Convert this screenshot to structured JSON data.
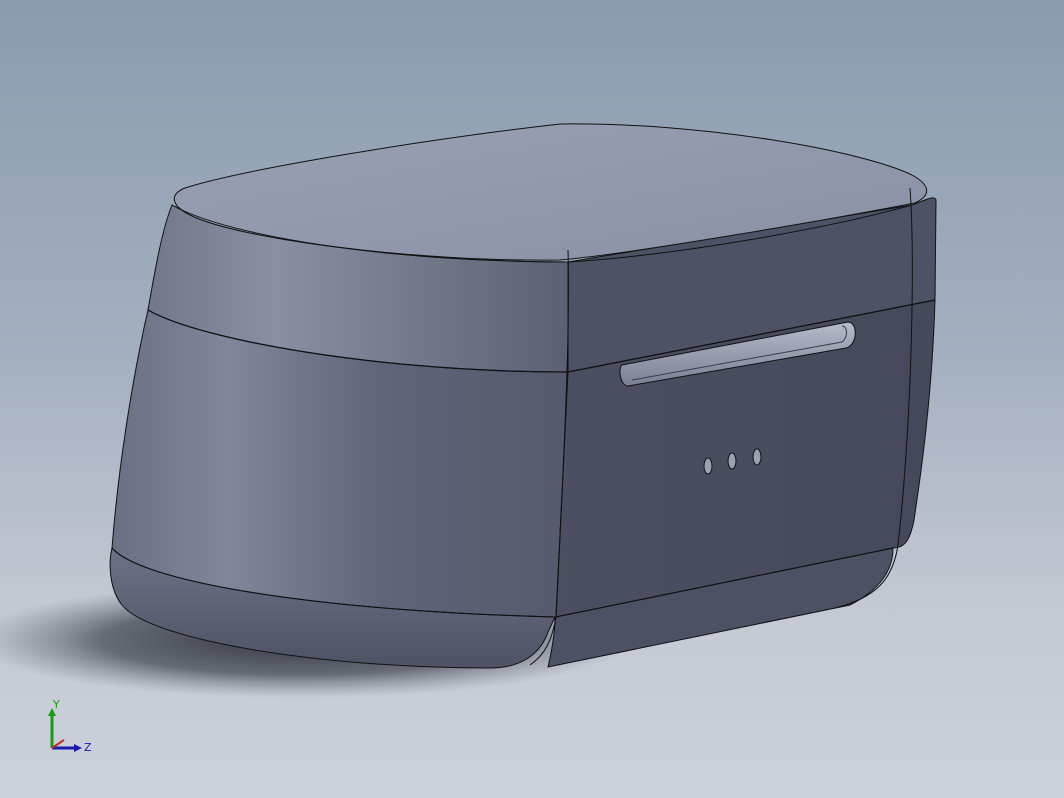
{
  "viewport": {
    "background_top": "#8b9bb0",
    "background_bottom": "#cdd1da"
  },
  "model": {
    "body_color": "#5a5f72",
    "front_color": "#4a4f60",
    "lid_top_color": "#979cb0",
    "edge_color": "#111111",
    "charging_contacts": 3
  },
  "triad": {
    "y_label": "Y",
    "z_label": "Z",
    "y_color": "#1a9a1a",
    "z_color": "#1a1ab0",
    "x_color": "#c03020"
  }
}
